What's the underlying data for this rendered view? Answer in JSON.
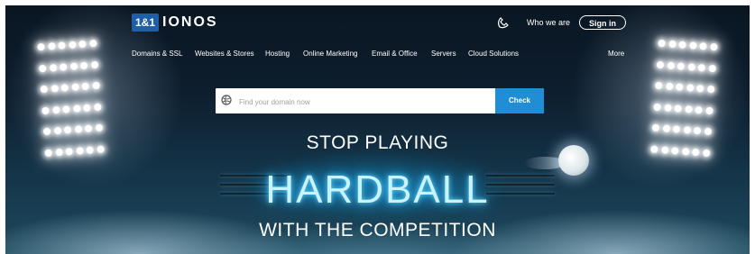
{
  "brand": {
    "logo_box": "1&1",
    "logo_text": "IONOS"
  },
  "header": {
    "who_we_are": "Who we are",
    "sign_in": "Sign in"
  },
  "nav": {
    "items": [
      "Domains & SSL",
      "Websites & Stores",
      "Hosting",
      "Online Marketing",
      "Email & Office",
      "Servers",
      "Cloud Solutions"
    ],
    "more": "More"
  },
  "search": {
    "placeholder": "Find your domain now",
    "button": "Check"
  },
  "hero": {
    "line1": "STOP PLAYING",
    "line2": "HARDBALL",
    "line3": "WITH THE COMPETITION"
  },
  "icons": {
    "phone": "phone-icon",
    "globe": "globe-icon"
  },
  "colors": {
    "brand_blue": "#1f5fa8",
    "check_blue": "#1f8ed6",
    "neon": "#5ed8ff"
  }
}
